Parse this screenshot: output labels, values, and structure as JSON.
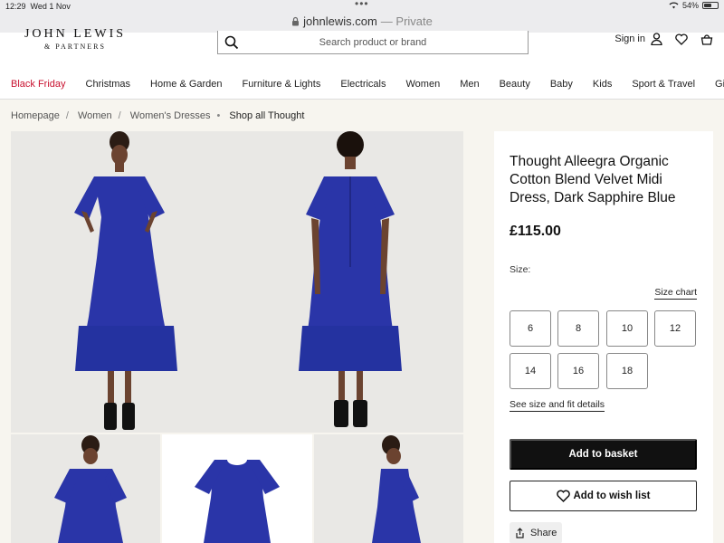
{
  "status_bar": {
    "time": "12:29",
    "date": "Wed 1 Nov",
    "battery": "54%",
    "battery_level": 0.54
  },
  "browser": {
    "url": "johnlewis.com",
    "mode": "— Private"
  },
  "header": {
    "logo_line1": "JOHN LEWIS",
    "logo_line2": "& PARTNERS",
    "search_placeholder": "Search product or brand",
    "sign_in": "Sign in"
  },
  "nav": {
    "items": [
      "Black Friday",
      "Christmas",
      "Home & Garden",
      "Furniture & Lights",
      "Electricals",
      "Women",
      "Men",
      "Beauty",
      "Baby",
      "Kids",
      "Sport & Travel",
      "Gifts"
    ]
  },
  "breadcrumb": {
    "items": [
      "Homepage",
      "Women",
      "Women's Dresses"
    ],
    "current": "Shop all Thought"
  },
  "product": {
    "title": "Thought Alleegra Organic Cotton Blend Velvet Midi Dress, Dark Sapphire Blue",
    "price": "£115.00",
    "size_label": "Size:",
    "size_chart": "Size chart",
    "sizes": [
      "6",
      "8",
      "10",
      "12",
      "14",
      "16",
      "18"
    ],
    "fit_link": "See size and fit details",
    "add_to_basket": "Add to basket",
    "add_to_wishlist": "Add to wish list",
    "share": "Share"
  },
  "colors": {
    "accent_red": "#c8102e",
    "dress_blue": "#2a35a8",
    "button_dark": "#111111"
  },
  "icons": {
    "search": "search-icon",
    "user": "user-icon",
    "heart": "heart-icon",
    "basket": "basket-icon",
    "share": "share-icon",
    "lock": "lock-icon",
    "wifi": "wifi-icon"
  }
}
